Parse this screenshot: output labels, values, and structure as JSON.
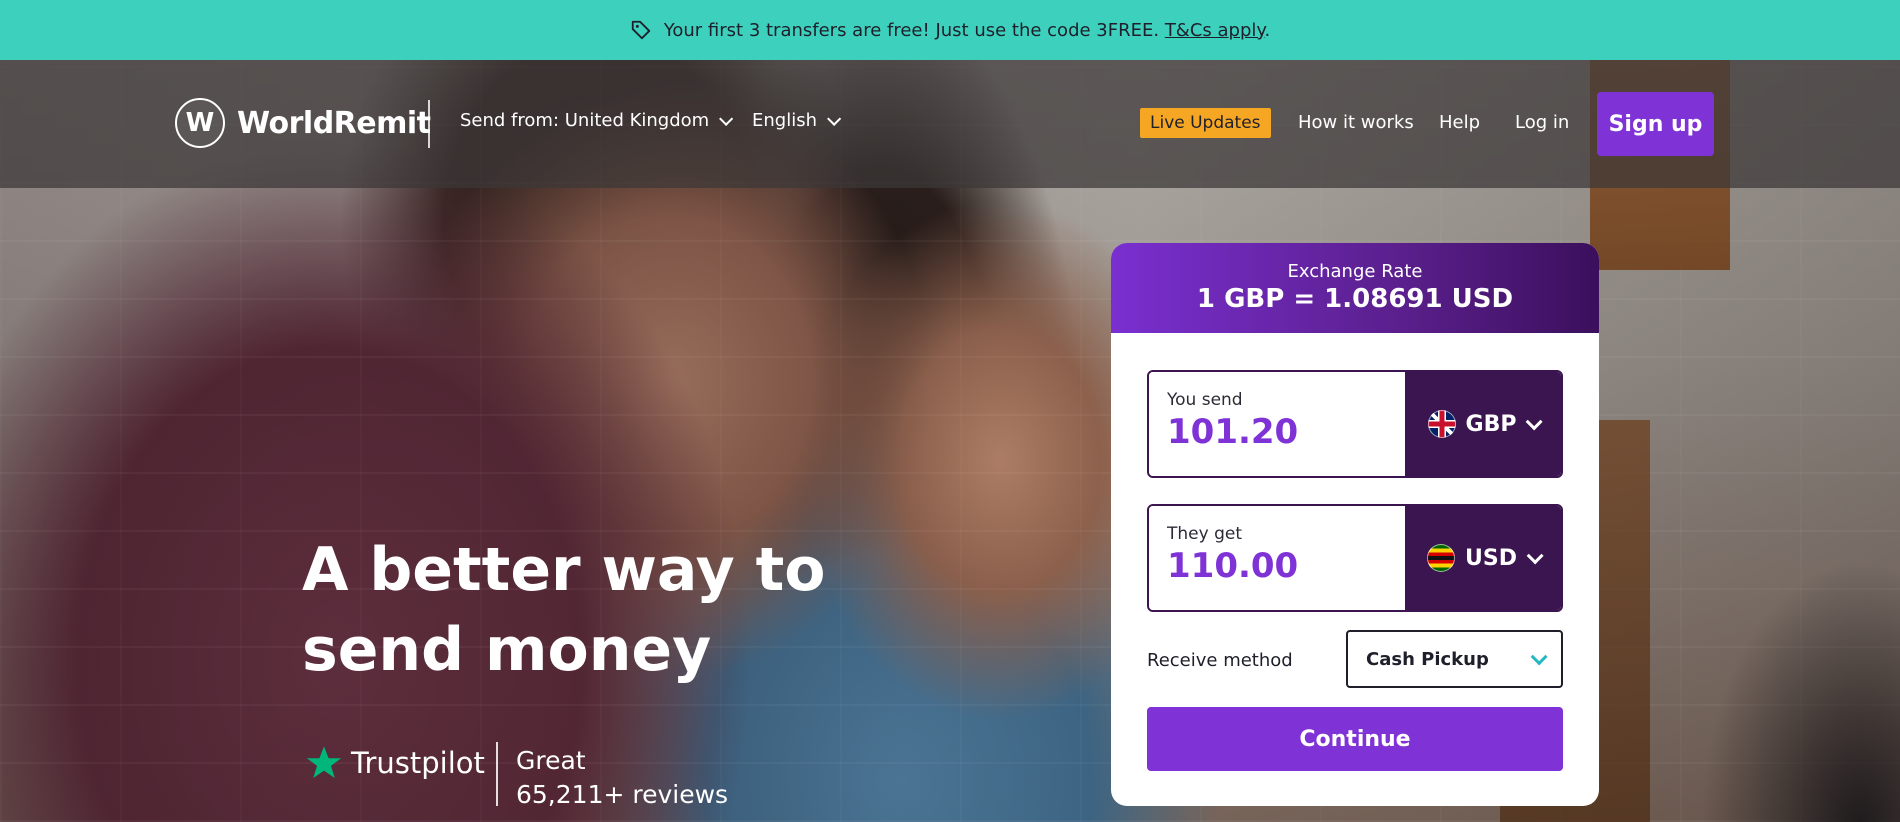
{
  "promo": {
    "text": "Your first 3 transfers are free! Just use the code 3FREE.",
    "link": "T&Cs apply",
    "suffix": "."
  },
  "header": {
    "logo_mark": "W",
    "logo_text": "WorldRemit",
    "send_from": "Send from: United Kingdom",
    "language": "English",
    "live_updates": "Live Updates",
    "how_it_works": "How it works",
    "help": "Help",
    "login": "Log in",
    "signup": "Sign up"
  },
  "hero": {
    "title": "A better way to send money"
  },
  "trustpilot": {
    "name": "Trustpilot",
    "rating": "Great",
    "reviews": "65,211+ reviews"
  },
  "converter": {
    "rate_label": "Exchange Rate",
    "rate_value": "1 GBP = 1.08691 USD",
    "send_label": "You send",
    "send_amount": "101.20",
    "send_currency": "GBP",
    "get_label": "They get",
    "get_amount": "110.00",
    "get_currency": "USD",
    "receive_label": "Receive method",
    "receive_value": "Cash Pickup",
    "continue": "Continue"
  },
  "colors": {
    "promo_bg": "#3cd0bd",
    "brand_purple": "#7f33d6",
    "dark_purple": "#3a1550",
    "live_updates_bg": "#f5a623",
    "trustpilot_green": "#00b67a"
  }
}
